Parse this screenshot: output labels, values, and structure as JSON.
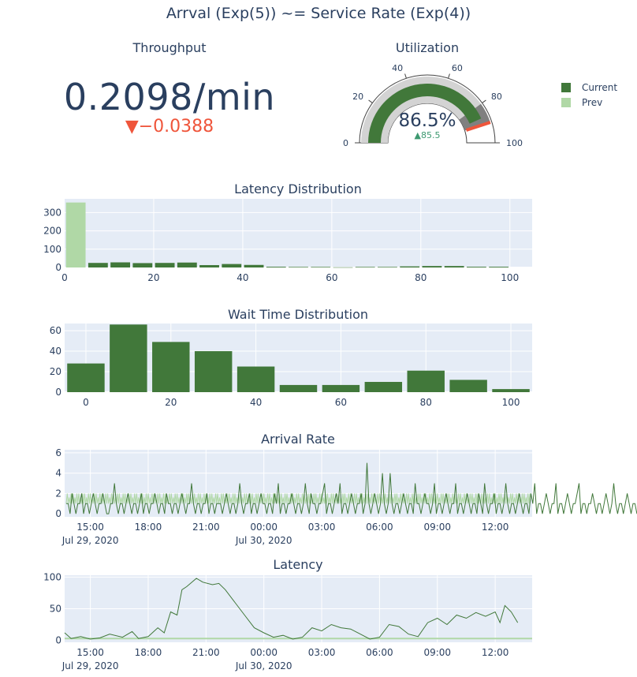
{
  "title": "Arrval (Exp(5)) ~= Service Rate (Exp(4))",
  "colors": {
    "current": "#41783a",
    "prev": "#b0d8a6",
    "plot_bg": "#e5ecf6",
    "negative": "#ef553b"
  },
  "legend": [
    {
      "label": "Current",
      "color": "#41783a"
    },
    {
      "label": "Prev",
      "color": "#b0d8a6"
    }
  ],
  "throughput": {
    "title": "Throughput",
    "value_text": "0.2098/min",
    "delta_text": "▼−0.0388",
    "delta": -0.0388
  },
  "utilization": {
    "title": "Utilization",
    "value": 86.5,
    "value_text": "86.5%",
    "reference_text": "▲85.5",
    "reference": 85.5,
    "axis_range": [
      0,
      100
    ],
    "ticks": [
      "0",
      "20",
      "40",
      "60",
      "80",
      "100"
    ],
    "threshold": 90,
    "step_range": [
      80,
      90
    ]
  },
  "time_ticks": [
    {
      "l1": "15:00",
      "l2": "Jul 29, 2020"
    },
    {
      "l1": "18:00",
      "l2": ""
    },
    {
      "l1": "21:00",
      "l2": ""
    },
    {
      "l1": "00:00",
      "l2": "Jul 30, 2020"
    },
    {
      "l1": "03:00",
      "l2": ""
    },
    {
      "l1": "06:00",
      "l2": ""
    },
    {
      "l1": "09:00",
      "l2": ""
    },
    {
      "l1": "12:00",
      "l2": ""
    }
  ],
  "chart_data": [
    {
      "type": "bar",
      "title": "Latency Distribution",
      "x_ticks": [
        "0",
        "20",
        "40",
        "60",
        "80",
        "100"
      ],
      "xlim": [
        0,
        105
      ],
      "ylim": [
        0,
        375
      ],
      "y_ticks": [
        0,
        100,
        200,
        300
      ],
      "bin_width": 5,
      "series": [
        {
          "name": "Prev",
          "bins_start": [
            0
          ],
          "values": [
            355
          ]
        },
        {
          "name": "Current",
          "bins_start": [
            5,
            10,
            15,
            20,
            25,
            30,
            35,
            40,
            45,
            50,
            55,
            60,
            65,
            70,
            75,
            80,
            85,
            90,
            95
          ],
          "values": [
            25,
            28,
            24,
            25,
            27,
            13,
            19,
            14,
            4,
            3,
            3,
            1,
            3,
            3,
            6,
            8,
            8,
            4,
            4
          ]
        }
      ]
    },
    {
      "type": "bar",
      "title": "Wait Time Distribution",
      "x_ticks": [
        "0",
        "20",
        "40",
        "60",
        "80",
        "100"
      ],
      "xlim": [
        -5,
        105
      ],
      "ylim": [
        0,
        67
      ],
      "y_ticks": [
        0,
        20,
        40,
        60
      ],
      "bin_width": 10,
      "series": [
        {
          "name": "Current",
          "bins_start": [
            -5,
            5,
            15,
            25,
            35,
            45,
            55,
            65,
            75,
            85,
            95
          ],
          "values": [
            28,
            66,
            49,
            40,
            25,
            7,
            7,
            10,
            21,
            12,
            3
          ]
        }
      ]
    },
    {
      "type": "line",
      "title": "Arrival Rate",
      "x_range": [
        "2020-07-29 13:40",
        "2020-07-30 13:55"
      ],
      "ylim": [
        -0.3,
        6.3
      ],
      "y_ticks": [
        0,
        2,
        4,
        6
      ],
      "series": [
        {
          "name": "Current",
          "x_start": "2020-07-29 13:45",
          "x_step_minutes": 6,
          "values": [
            1,
            1,
            0,
            2,
            1,
            0,
            1,
            1,
            2,
            0,
            1,
            1,
            0,
            1,
            2,
            1,
            0,
            1,
            1,
            2,
            1,
            0,
            0,
            1,
            1,
            3,
            1,
            0,
            1,
            1,
            0,
            1,
            2,
            1,
            0,
            1,
            1,
            0,
            1,
            2,
            0,
            1,
            1,
            0,
            1,
            1,
            2,
            1,
            0,
            1,
            1,
            0,
            2,
            1,
            1,
            0,
            1,
            1,
            0,
            1,
            2,
            1,
            0,
            1,
            1,
            3,
            1,
            0,
            1,
            1,
            0,
            1,
            1,
            2,
            0,
            1,
            1,
            0,
            1,
            1,
            1,
            0,
            1,
            2,
            1,
            0,
            1,
            1,
            0,
            1,
            3,
            1,
            0,
            1,
            1,
            2,
            0,
            1,
            1,
            0,
            1,
            2,
            1,
            1,
            0,
            1,
            1,
            0,
            2,
            1,
            3,
            0,
            1,
            1,
            0,
            1,
            1,
            2,
            1,
            0,
            1,
            1,
            0,
            1,
            3,
            1,
            0,
            2,
            1,
            1,
            0,
            1,
            1,
            2,
            3,
            0,
            1,
            1,
            0,
            1,
            2,
            1,
            3,
            0,
            1,
            1,
            0,
            1,
            2,
            1,
            0,
            1,
            1,
            2,
            0,
            1,
            5,
            1,
            0,
            1,
            2,
            1,
            0,
            1,
            4,
            1,
            0,
            1,
            4,
            1,
            0,
            1,
            1,
            0,
            1,
            2,
            1,
            0,
            1,
            1,
            0,
            3,
            1,
            1,
            0,
            1,
            2,
            1,
            1,
            0,
            1,
            3,
            0,
            1,
            1,
            0,
            1,
            2,
            1,
            0,
            1,
            1,
            3,
            0,
            1,
            1,
            0,
            1,
            2,
            1,
            0,
            1,
            1,
            0,
            2,
            1,
            0,
            3,
            1,
            0,
            1,
            1,
            2,
            0,
            1,
            1,
            0,
            1,
            3,
            1,
            0,
            1,
            1,
            0,
            1,
            2,
            1,
            0,
            1,
            1,
            0,
            2,
            1,
            3,
            0,
            1,
            1,
            0,
            1,
            2,
            1,
            0,
            1,
            1,
            3,
            0,
            1,
            1,
            0,
            1,
            2,
            1,
            0,
            1,
            1,
            2,
            3,
            0,
            1,
            1,
            0,
            1,
            1,
            2,
            1,
            0,
            1,
            1,
            0,
            1,
            2,
            1,
            0,
            1,
            3,
            1,
            0,
            1,
            1,
            0,
            1,
            2,
            1,
            0,
            1,
            1,
            0,
            1,
            2,
            1,
            0,
            1,
            1,
            0,
            1,
            2,
            1,
            3,
            0,
            1,
            1,
            0,
            1,
            2,
            1,
            0,
            1,
            1,
            0,
            2,
            1,
            0,
            1,
            1,
            0,
            1,
            2,
            1,
            0,
            1,
            1,
            0,
            1,
            3,
            1,
            0,
            1,
            1,
            0,
            2,
            1,
            1,
            0,
            1,
            1,
            0,
            1,
            2,
            1,
            0,
            1,
            1,
            0,
            1,
            2,
            1,
            0,
            1,
            1,
            0,
            1,
            2,
            1,
            0,
            1,
            3,
            1,
            0,
            1,
            1,
            0,
            1,
            2,
            1,
            6,
            0,
            1,
            1,
            0,
            1,
            2,
            1,
            0,
            1,
            1,
            0,
            2,
            1,
            0,
            1,
            1,
            0,
            1,
            2,
            1,
            0,
            1,
            1,
            0,
            1
          ]
        },
        {
          "name": "Prev",
          "x_start": "2020-07-29 13:45",
          "x_step_minutes": 3,
          "pattern": [
            1,
            2,
            1,
            1.6,
            1,
            2
          ]
        }
      ]
    },
    {
      "type": "line",
      "title": "Latency",
      "x_range": [
        "2020-07-29 13:40",
        "2020-07-30 13:55"
      ],
      "ylim": [
        -3,
        103
      ],
      "y_ticks": [
        0,
        50,
        100
      ],
      "series": [
        {
          "name": "Current",
          "points": [
            [
              "2020-07-29 13:40",
              12
            ],
            [
              "2020-07-29 14:00",
              3
            ],
            [
              "2020-07-29 14:30",
              6
            ],
            [
              "2020-07-29 15:00",
              2
            ],
            [
              "2020-07-29 15:30",
              4
            ],
            [
              "2020-07-29 16:00",
              10
            ],
            [
              "2020-07-29 16:40",
              5
            ],
            [
              "2020-07-29 17:10",
              14
            ],
            [
              "2020-07-29 17:30",
              3
            ],
            [
              "2020-07-29 18:00",
              6
            ],
            [
              "2020-07-29 18:30",
              20
            ],
            [
              "2020-07-29 18:50",
              12
            ],
            [
              "2020-07-29 19:10",
              45
            ],
            [
              "2020-07-29 19:30",
              40
            ],
            [
              "2020-07-29 19:45",
              80
            ],
            [
              "2020-07-29 20:00",
              85
            ],
            [
              "2020-07-29 20:30",
              98
            ],
            [
              "2020-07-29 20:50",
              92
            ],
            [
              "2020-07-29 21:20",
              88
            ],
            [
              "2020-07-29 21:40",
              90
            ],
            [
              "2020-07-29 22:00",
              80
            ],
            [
              "2020-07-29 22:30",
              60
            ],
            [
              "2020-07-29 23:00",
              40
            ],
            [
              "2020-07-29 23:30",
              20
            ],
            [
              "2020-07-30 00:00",
              12
            ],
            [
              "2020-07-30 00:30",
              5
            ],
            [
              "2020-07-30 01:00",
              8
            ],
            [
              "2020-07-30 01:30",
              2
            ],
            [
              "2020-07-30 02:00",
              5
            ],
            [
              "2020-07-30 02:30",
              20
            ],
            [
              "2020-07-30 03:00",
              15
            ],
            [
              "2020-07-30 03:30",
              25
            ],
            [
              "2020-07-30 04:00",
              20
            ],
            [
              "2020-07-30 04:30",
              18
            ],
            [
              "2020-07-30 05:00",
              10
            ],
            [
              "2020-07-30 05:30",
              2
            ],
            [
              "2020-07-30 06:00",
              5
            ],
            [
              "2020-07-30 06:30",
              25
            ],
            [
              "2020-07-30 07:00",
              22
            ],
            [
              "2020-07-30 07:30",
              10
            ],
            [
              "2020-07-30 08:00",
              6
            ],
            [
              "2020-07-30 08:30",
              28
            ],
            [
              "2020-07-30 09:00",
              35
            ],
            [
              "2020-07-30 09:30",
              25
            ],
            [
              "2020-07-30 10:00",
              40
            ],
            [
              "2020-07-30 10:30",
              35
            ],
            [
              "2020-07-30 11:00",
              44
            ],
            [
              "2020-07-30 11:30",
              38
            ],
            [
              "2020-07-30 12:00",
              45
            ],
            [
              "2020-07-30 12:15",
              28
            ],
            [
              "2020-07-30 12:30",
              55
            ],
            [
              "2020-07-30 12:50",
              45
            ],
            [
              "2020-07-30 13:10",
              28
            ]
          ]
        },
        {
          "name": "Prev",
          "constant": 3
        }
      ]
    }
  ]
}
